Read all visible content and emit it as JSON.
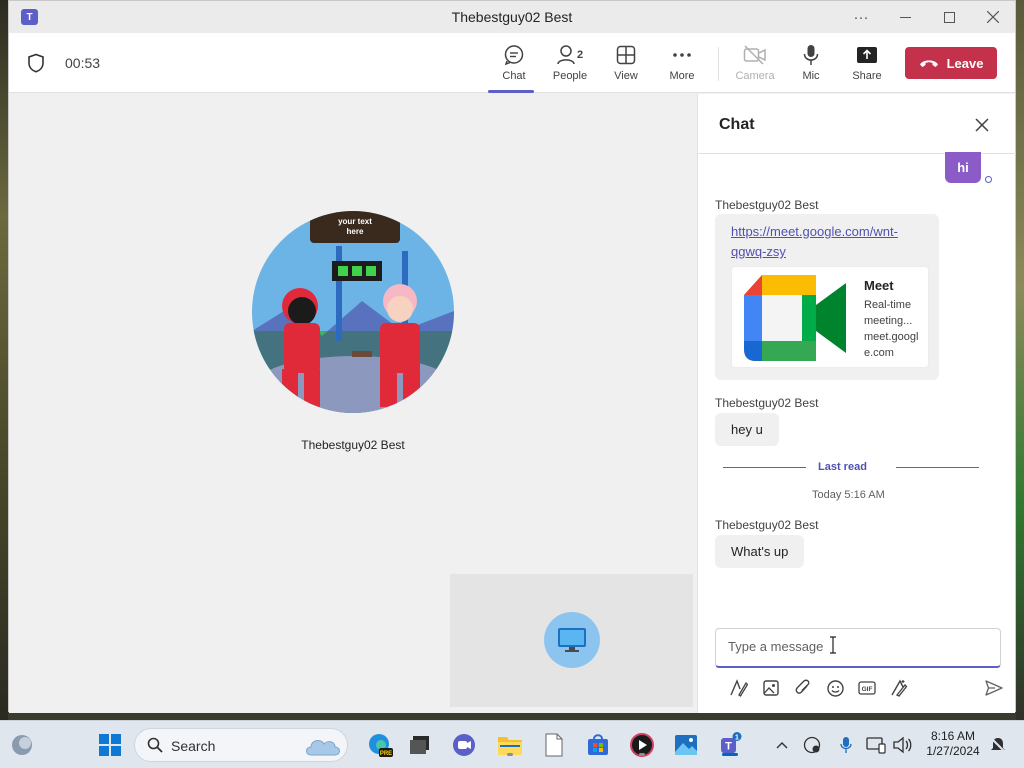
{
  "window": {
    "title": "Thebestguy02 Best",
    "app_logo_text": "T"
  },
  "meeting": {
    "timer": "00:53",
    "controls": [
      {
        "id": "chat",
        "label": "Chat"
      },
      {
        "id": "people",
        "label": "People",
        "count": "2"
      },
      {
        "id": "view",
        "label": "View"
      },
      {
        "id": "more",
        "label": "More"
      },
      {
        "id": "camera",
        "label": "Camera"
      },
      {
        "id": "mic",
        "label": "Mic"
      },
      {
        "id": "share",
        "label": "Share"
      }
    ],
    "leave_label": "Leave",
    "accent_color": "#5b5fc7",
    "leave_color": "#c4314b"
  },
  "stage": {
    "participant_name": "Thebestguy02 Best",
    "avatar_sign_text": "your text here"
  },
  "chat": {
    "title": "Chat",
    "my_message": "hi",
    "messages": [
      {
        "sender": "Thebestguy02 Best",
        "link": "https://meet.google.com/wnt-qgwq-zsy",
        "card": {
          "title": "Meet",
          "description": "Real-time meeting...",
          "domain": "meet.google.com"
        }
      },
      {
        "sender": "Thebestguy02 Best",
        "text": "hey u"
      },
      {
        "sender": "Thebestguy02 Best",
        "text": "What's up"
      }
    ],
    "last_read_label": "Last read",
    "timestamp": "Today 5:16 AM",
    "compose_placeholder": "Type a message"
  },
  "taskbar": {
    "search_label": "Search",
    "time": "8:16 AM",
    "date": "1/27/2024",
    "teams_badge": "1",
    "edge_badge": "PRE"
  }
}
